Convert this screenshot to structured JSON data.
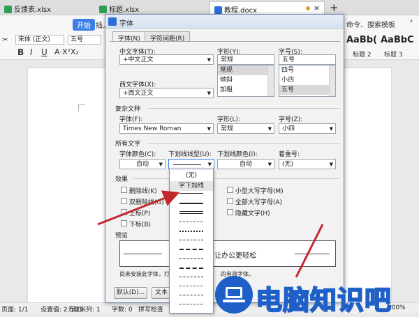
{
  "tabs": [
    {
      "label": "反馈表.xlsx",
      "color": "#2e9e54"
    },
    {
      "label": "标题.xlsx",
      "color": "#2e9e54"
    },
    {
      "label": "教程.docx",
      "color": "#2b6fd6"
    }
  ],
  "tab_plus": "+",
  "ribbon": {
    "start_label": "开始",
    "insert_label": "插入",
    "font_value": "宋体 (正文)",
    "size_value": "五号",
    "search_label": "命令、搜索模板",
    "style1": "AaBb(",
    "style2": "AaBbC",
    "style1_name": "标题 2",
    "style2_name": "标题 3",
    "bold": "B",
    "italic": "I",
    "underline": "U"
  },
  "dialog": {
    "title": "字体",
    "tabs": [
      "字体(N)",
      "字符间距(R)"
    ],
    "chinese_font_label": "中文字体(T):",
    "chinese_font_value": "+中文正文",
    "western_font_label": "西文字体(X):",
    "western_font_value": "+西文正文",
    "style_label": "字形(Y):",
    "style_value": "常规",
    "style_list": [
      "常规",
      "倾斜",
      "加粗"
    ],
    "size_label": "字号(S):",
    "size_value": "五号",
    "size_list": [
      "四号",
      "小四",
      "五号"
    ],
    "complex_section": "复杂文种",
    "complex_font_label": "字体(F):",
    "complex_font_value": "Times New Roman",
    "complex_style_label": "字形(L):",
    "complex_style_value": "常规",
    "complex_size_label": "字号(Z):",
    "complex_size_value": "小四",
    "all_text_section": "所有文字",
    "font_color_label": "字体颜色(C):",
    "font_color_value": "自动",
    "underline_type_label": "下划线线型(U):",
    "underline_color_label": "下划线颜色(I):",
    "underline_color_value": "自动",
    "emphasis_label": "着重号:",
    "emphasis_value": "(无)",
    "effects_section": "效果",
    "effects_left": [
      "删除线(K)",
      "双删除线(G)",
      "上标(P)",
      "下标(B)"
    ],
    "effects_right": [
      "小型大写字母(M)",
      "全部大写字母(A)",
      "隐藏文字(H)"
    ],
    "preview_section": "预览",
    "preview_text": "让办公更轻松",
    "note_text": "尚未安装此字体，打",
    "note_text2": "的有效字体。",
    "default_btn": "默认(D)...",
    "text_effect_btn": "文本效"
  },
  "dropdown": {
    "none": "(无)",
    "word_underline": "字下加线"
  },
  "status": {
    "page": "页面: 1/1",
    "setting": "设置值: 2.5厘米",
    "row": "行: 1",
    "col": "列: 1",
    "words": "字数: 0",
    "spell": "拼写检查",
    "zoom": "100%"
  },
  "watermark": {
    "text": "电脑知识吧"
  },
  "colors": {
    "arrow": "#c0282e",
    "accent": "#3c7ee8",
    "wm_blue": "#1f5fc8"
  }
}
